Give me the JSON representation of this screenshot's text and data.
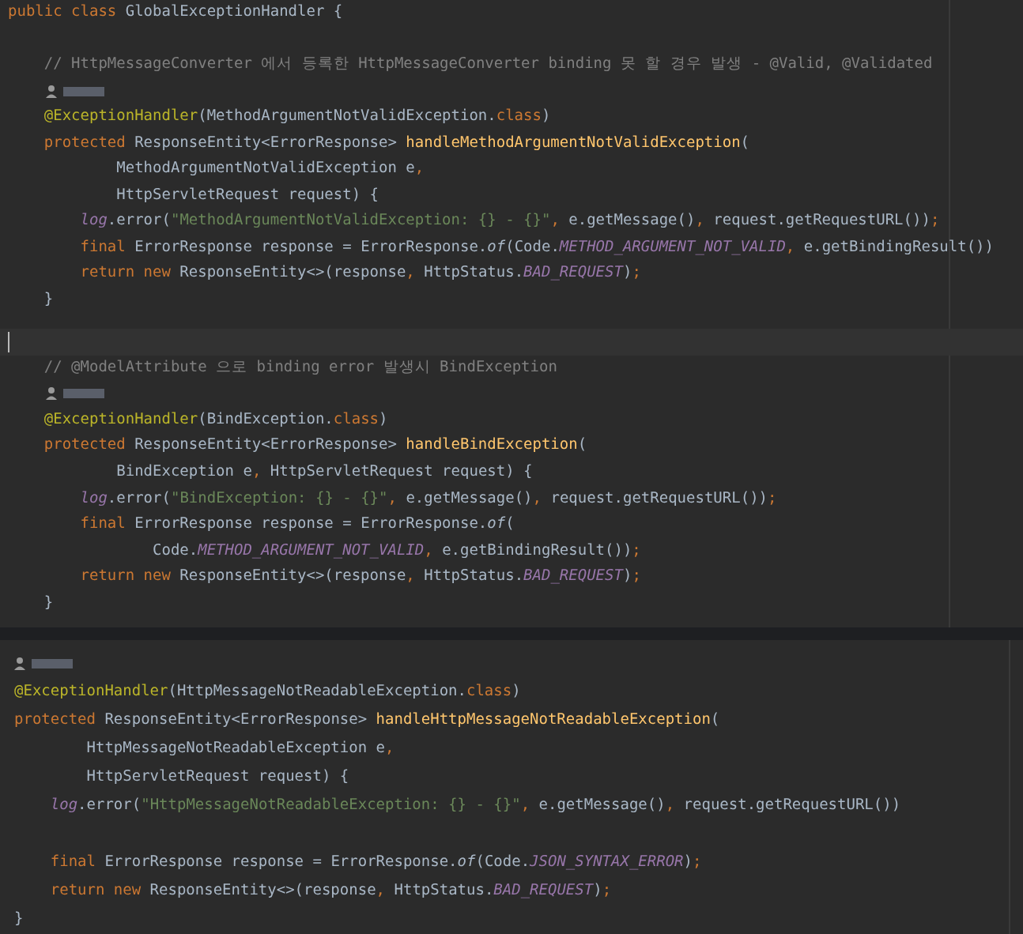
{
  "panels": [
    {
      "lines": [
        {
          "kind": "code",
          "tokens": [
            {
              "text": "public class ",
              "kind": "kw"
            },
            {
              "text": "GlobalExceptionHandler {",
              "kind": "plain"
            }
          ]
        },
        {
          "kind": "blank"
        },
        {
          "kind": "code",
          "tokens": [
            {
              "text": "    // HttpMessageConverter 에서 등록한 HttpMessageConverter binding 못 할 경우 발생 - @Valid, @Validated",
              "kind": "comment"
            }
          ]
        },
        {
          "kind": "author-hint"
        },
        {
          "kind": "code",
          "tokens": [
            {
              "text": "    @ExceptionHandler",
              "kind": "ann"
            },
            {
              "text": "(MethodArgumentNotValidException.",
              "kind": "plain"
            },
            {
              "text": "class",
              "kind": "kw"
            },
            {
              "text": ")",
              "kind": "plain"
            }
          ]
        },
        {
          "kind": "code",
          "tokens": [
            {
              "text": "    protected ",
              "kind": "kw"
            },
            {
              "text": "ResponseEntity<ErrorResponse> ",
              "kind": "plain"
            },
            {
              "text": "handleMethodArgumentNotValidException",
              "kind": "method"
            },
            {
              "text": "(",
              "kind": "plain"
            }
          ]
        },
        {
          "kind": "code",
          "tokens": [
            {
              "text": "            MethodArgumentNotValidException e",
              "kind": "plain"
            },
            {
              "text": ",",
              "kind": "kw"
            }
          ]
        },
        {
          "kind": "code",
          "tokens": [
            {
              "text": "            HttpServletRequest request) {",
              "kind": "plain"
            }
          ]
        },
        {
          "kind": "code",
          "tokens": [
            {
              "text": "        log",
              "kind": "field"
            },
            {
              "text": ".error(",
              "kind": "plain"
            },
            {
              "text": "\"MethodArgumentNotValidException: {} - {}\"",
              "kind": "string"
            },
            {
              "text": ", ",
              "kind": "kw"
            },
            {
              "text": "e.getMessage()",
              "kind": "plain"
            },
            {
              "text": ", ",
              "kind": "kw"
            },
            {
              "text": "request.getRequestURL())",
              "kind": "plain"
            },
            {
              "text": ";",
              "kind": "kw"
            }
          ]
        },
        {
          "kind": "code",
          "tokens": [
            {
              "text": "        final ",
              "kind": "kw"
            },
            {
              "text": "ErrorResponse response = ErrorResponse.",
              "kind": "plain"
            },
            {
              "text": "of",
              "kind": "italic"
            },
            {
              "text": "(Code.",
              "kind": "plain"
            },
            {
              "text": "METHOD_ARGUMENT_NOT_VALID",
              "kind": "const"
            },
            {
              "text": ", ",
              "kind": "kw"
            },
            {
              "text": "e.getBindingResult())",
              "kind": "plain"
            }
          ]
        },
        {
          "kind": "code",
          "tokens": [
            {
              "text": "        return new ",
              "kind": "kw"
            },
            {
              "text": "ResponseEntity<>(response",
              "kind": "plain"
            },
            {
              "text": ", ",
              "kind": "kw"
            },
            {
              "text": "HttpStatus.",
              "kind": "plain"
            },
            {
              "text": "BAD_REQUEST",
              "kind": "const"
            },
            {
              "text": ")",
              "kind": "plain"
            },
            {
              "text": ";",
              "kind": "kw"
            }
          ]
        },
        {
          "kind": "code",
          "tokens": [
            {
              "text": "    }",
              "kind": "plain"
            }
          ]
        }
      ]
    },
    {
      "lines": [
        {
          "kind": "caret"
        },
        {
          "kind": "code",
          "tokens": [
            {
              "text": "    // @ModelAttribute 으로 binding error 발생시 BindException",
              "kind": "comment"
            }
          ]
        },
        {
          "kind": "author-hint"
        },
        {
          "kind": "code",
          "tokens": [
            {
              "text": "    @ExceptionHandler",
              "kind": "ann"
            },
            {
              "text": "(BindException.",
              "kind": "plain"
            },
            {
              "text": "class",
              "kind": "kw"
            },
            {
              "text": ")",
              "kind": "plain"
            }
          ]
        },
        {
          "kind": "code",
          "tokens": [
            {
              "text": "    protected ",
              "kind": "kw"
            },
            {
              "text": "ResponseEntity<ErrorResponse> ",
              "kind": "plain"
            },
            {
              "text": "handleBindException",
              "kind": "method"
            },
            {
              "text": "(",
              "kind": "plain"
            }
          ]
        },
        {
          "kind": "code",
          "tokens": [
            {
              "text": "            BindException e",
              "kind": "plain"
            },
            {
              "text": ", ",
              "kind": "kw"
            },
            {
              "text": "HttpServletRequest request) {",
              "kind": "plain"
            }
          ]
        },
        {
          "kind": "code",
          "tokens": [
            {
              "text": "        log",
              "kind": "field"
            },
            {
              "text": ".error(",
              "kind": "plain"
            },
            {
              "text": "\"BindException: {} - {}\"",
              "kind": "string"
            },
            {
              "text": ", ",
              "kind": "kw"
            },
            {
              "text": "e.getMessage()",
              "kind": "plain"
            },
            {
              "text": ", ",
              "kind": "kw"
            },
            {
              "text": "request.getRequestURL())",
              "kind": "plain"
            },
            {
              "text": ";",
              "kind": "kw"
            }
          ]
        },
        {
          "kind": "code",
          "tokens": [
            {
              "text": "        final ",
              "kind": "kw"
            },
            {
              "text": "ErrorResponse response = ErrorResponse.",
              "kind": "plain"
            },
            {
              "text": "of",
              "kind": "italic"
            },
            {
              "text": "(",
              "kind": "plain"
            }
          ]
        },
        {
          "kind": "code",
          "tokens": [
            {
              "text": "                Code.",
              "kind": "plain"
            },
            {
              "text": "METHOD_ARGUMENT_NOT_VALID",
              "kind": "const"
            },
            {
              "text": ", ",
              "kind": "kw"
            },
            {
              "text": "e.getBindingResult())",
              "kind": "plain"
            },
            {
              "text": ";",
              "kind": "kw"
            }
          ]
        },
        {
          "kind": "code",
          "tokens": [
            {
              "text": "        return new ",
              "kind": "kw"
            },
            {
              "text": "ResponseEntity<>(response",
              "kind": "plain"
            },
            {
              "text": ", ",
              "kind": "kw"
            },
            {
              "text": "HttpStatus.",
              "kind": "plain"
            },
            {
              "text": "BAD_REQUEST",
              "kind": "const"
            },
            {
              "text": ")",
              "kind": "plain"
            },
            {
              "text": ";",
              "kind": "kw"
            }
          ]
        },
        {
          "kind": "code",
          "tokens": [
            {
              "text": "    }",
              "kind": "plain"
            }
          ]
        }
      ]
    },
    {
      "lines": [
        {
          "kind": "author-hint"
        },
        {
          "kind": "code",
          "tokens": [
            {
              "text": "@ExceptionHandler",
              "kind": "ann"
            },
            {
              "text": "(HttpMessageNotReadableException.",
              "kind": "plain"
            },
            {
              "text": "class",
              "kind": "kw"
            },
            {
              "text": ")",
              "kind": "plain"
            }
          ]
        },
        {
          "kind": "code",
          "tokens": [
            {
              "text": "protected ",
              "kind": "kw"
            },
            {
              "text": "ResponseEntity<ErrorResponse> ",
              "kind": "plain"
            },
            {
              "text": "handleHttpMessageNotReadableException",
              "kind": "method"
            },
            {
              "text": "(",
              "kind": "plain"
            }
          ]
        },
        {
          "kind": "code",
          "tokens": [
            {
              "text": "        HttpMessageNotReadableException e",
              "kind": "plain"
            },
            {
              "text": ",",
              "kind": "kw"
            }
          ]
        },
        {
          "kind": "code",
          "tokens": [
            {
              "text": "        HttpServletRequest request) {",
              "kind": "plain"
            }
          ]
        },
        {
          "kind": "code",
          "tokens": [
            {
              "text": "    log",
              "kind": "field"
            },
            {
              "text": ".error(",
              "kind": "plain"
            },
            {
              "text": "\"HttpMessageNotReadableException: {} - {}\"",
              "kind": "string"
            },
            {
              "text": ", ",
              "kind": "kw"
            },
            {
              "text": "e.getMessage()",
              "kind": "plain"
            },
            {
              "text": ", ",
              "kind": "kw"
            },
            {
              "text": "request.getRequestURL())",
              "kind": "plain"
            }
          ]
        },
        {
          "kind": "blank"
        },
        {
          "kind": "code",
          "tokens": [
            {
              "text": "    final ",
              "kind": "kw"
            },
            {
              "text": "ErrorResponse response = ErrorResponse.",
              "kind": "plain"
            },
            {
              "text": "of",
              "kind": "italic"
            },
            {
              "text": "(Code.",
              "kind": "plain"
            },
            {
              "text": "JSON_SYNTAX_ERROR",
              "kind": "const"
            },
            {
              "text": ")",
              "kind": "plain"
            },
            {
              "text": ";",
              "kind": "kw"
            }
          ]
        },
        {
          "kind": "code",
          "tokens": [
            {
              "text": "    return new ",
              "kind": "kw"
            },
            {
              "text": "ResponseEntity<>(response",
              "kind": "plain"
            },
            {
              "text": ", ",
              "kind": "kw"
            },
            {
              "text": "HttpStatus.",
              "kind": "plain"
            },
            {
              "text": "BAD_REQUEST",
              "kind": "const"
            },
            {
              "text": ")",
              "kind": "plain"
            },
            {
              "text": ";",
              "kind": "kw"
            }
          ]
        },
        {
          "kind": "code",
          "tokens": [
            {
              "text": "}",
              "kind": "plain"
            }
          ]
        }
      ]
    }
  ]
}
